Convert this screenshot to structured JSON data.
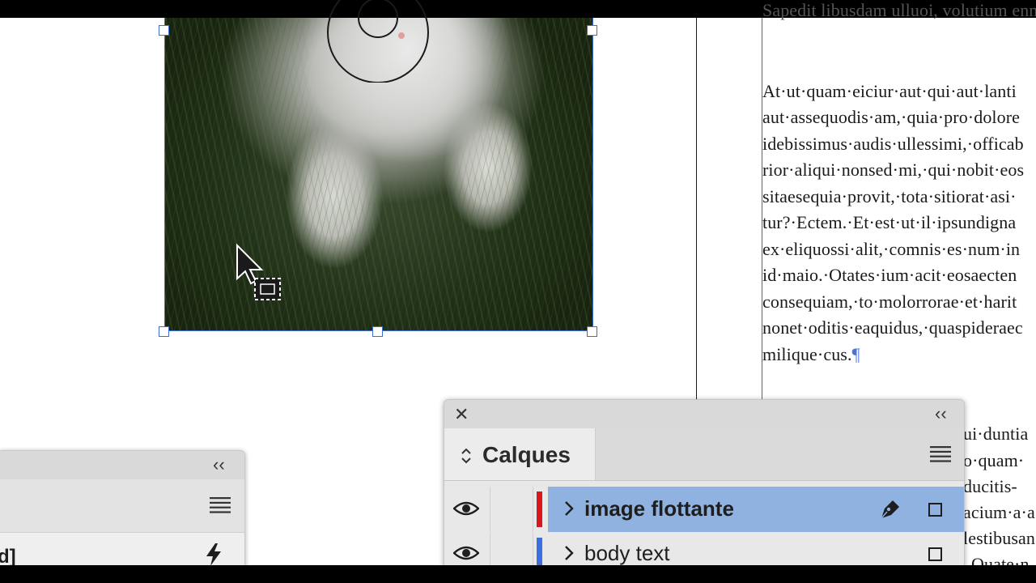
{
  "document": {
    "paragraph_top": "Sapedit libusdam ulluoi, volutium ennetur",
    "paragraph_main": [
      "At·ut·quam·eiciur·aut·qui·aut·lanti",
      "aut·assequodis·am,·quia·pro·dolore",
      "idebissimus·audis·ullessimi,·officab",
      "rior·aliqui·nonsed·mi,·qui·nobit·eos",
      "sitaesequia·provit,·tota·sitiorat·asi·",
      "tur?·Ectem.·Et·est·ut·il·ipsundigna",
      "ex·eliquossi·alit,·comnis·es·num·in",
      "id·maio.·Otates·ium·acit·eosaecten",
      "consequiam,·to·molorrorae·et·harit",
      "nonet·oditis·eaquidus,·quaspideraec",
      "milique·cus."
    ],
    "pilcrow": "¶",
    "paragraph_bottom_fragments": [
      "ui·duntia",
      "o·quam·",
      "ducitis-",
      "acium·a·a",
      "lestibusan",
      "Quate·n"
    ]
  },
  "left_panel": {
    "collapse_label": "‹‹",
    "menu_icon": "hamburger-menu-icon",
    "row_text_fragment": "d]",
    "row_icon": "lightning-icon"
  },
  "layers_panel": {
    "close_label": "✕",
    "collapse_label": "‹‹",
    "title": "Calques",
    "sort_icon": "up-down-chevron-icon",
    "menu_icon": "hamburger-menu-icon",
    "layers": [
      {
        "name": "image flottante",
        "color": "#d9161d",
        "selected": true,
        "visible": true,
        "has_pen": true
      },
      {
        "name": "body text",
        "color": "#3c6fe0",
        "selected": false,
        "visible": true,
        "has_pen": false
      }
    ]
  },
  "colors": {
    "selection_blue": "#3b6fd6",
    "layer_highlight": "#8fb2e0",
    "text_frame_guide": "#8a3fb6"
  }
}
